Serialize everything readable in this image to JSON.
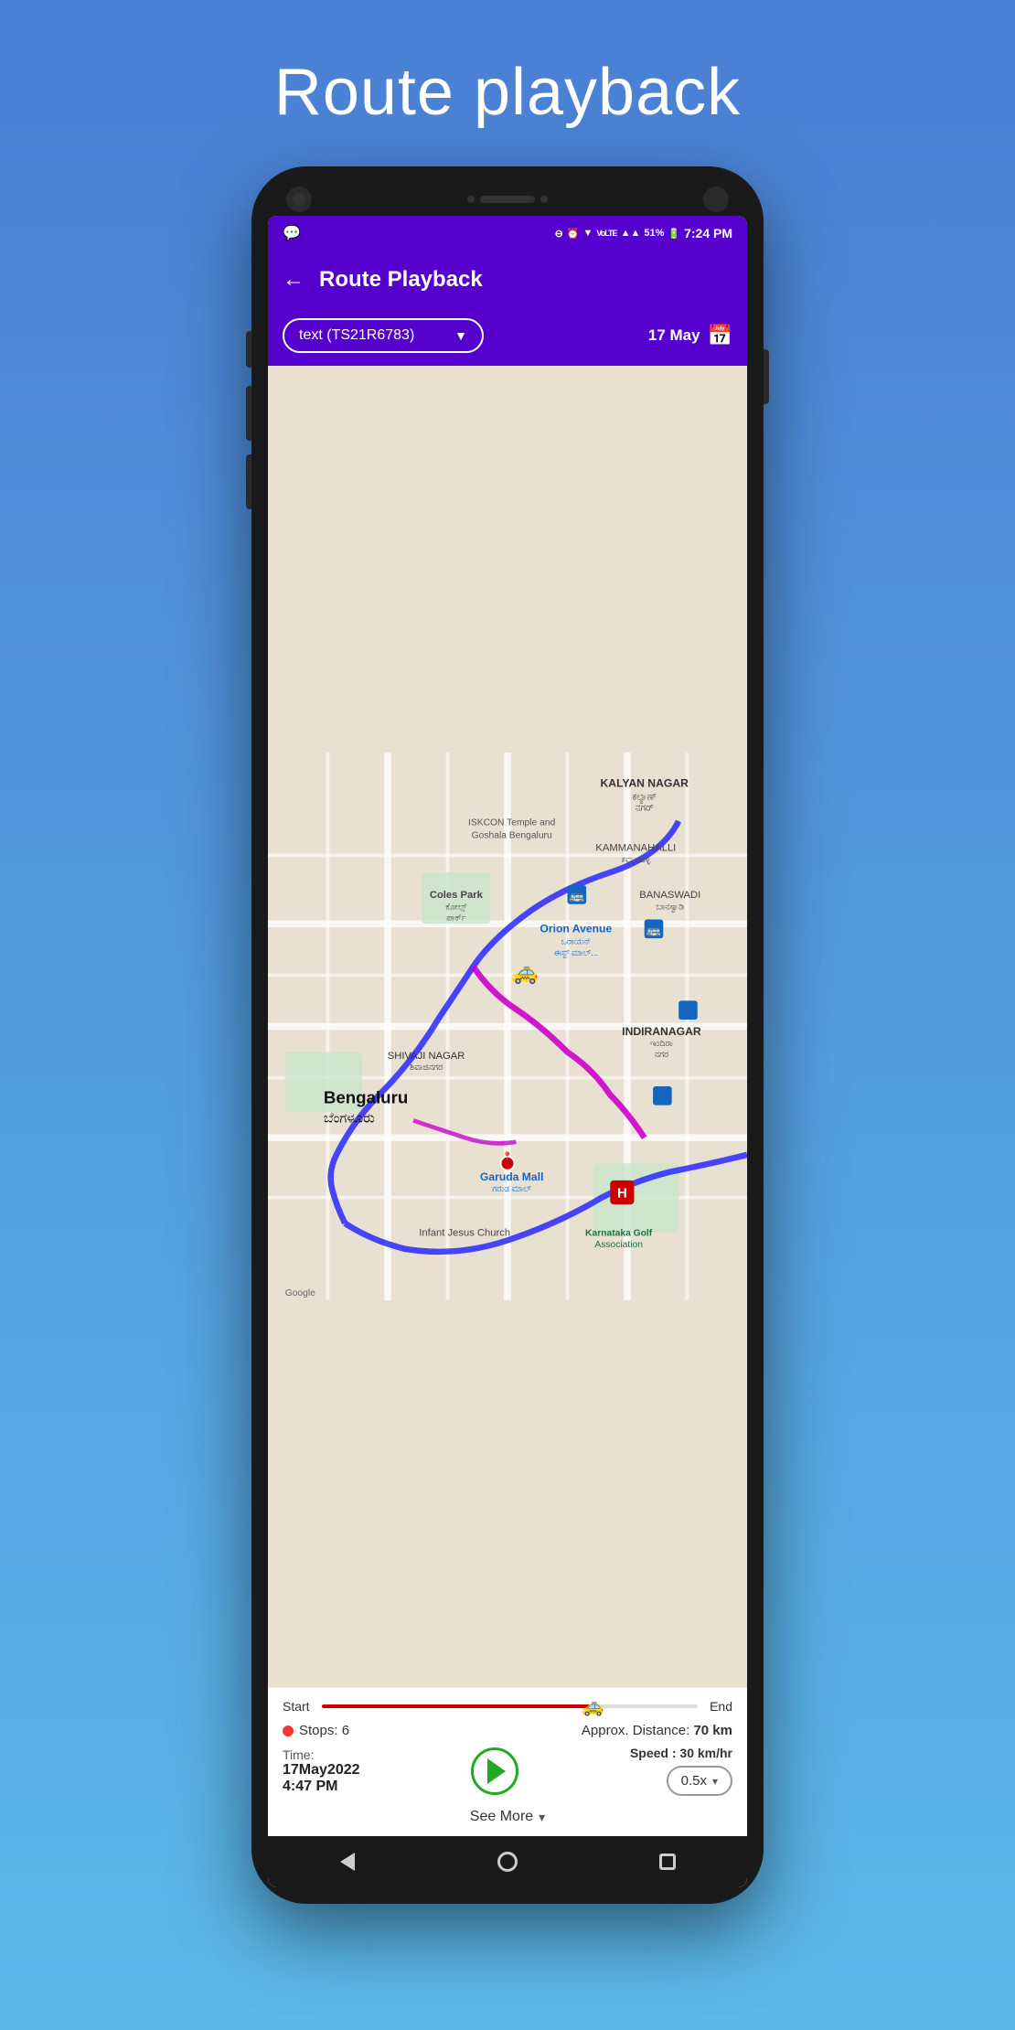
{
  "page": {
    "background_gradient_start": "#4a7fd4",
    "background_gradient_end": "#5bb8e8",
    "title": "Route playback"
  },
  "status_bar": {
    "battery": "51%",
    "time": "7:24 PM",
    "icons": [
      "whatsapp",
      "minus",
      "alarm",
      "wifi",
      "volte1",
      "volte2",
      "signal1",
      "signal2"
    ]
  },
  "app_bar": {
    "back_label": "←",
    "title": "Route Playback"
  },
  "toolbar": {
    "vehicle_label": "text (TS21R6783)",
    "dropdown_arrow": "▼",
    "date_label": "17 May",
    "calendar_icon": "📅"
  },
  "map": {
    "areas": [
      "KALYAN NAGAR",
      "KAMMANAHALLI",
      "BANASWADI",
      "INDIRANAGAR",
      "Coles Park",
      "Orion Avenue",
      "SHIVAJI NAGAR",
      "Garuda Mall",
      "Infant Jesus Church",
      "Karnataka Golf Association",
      "Bengaluru",
      "ISKCON Temple and Goshala Bengaluru"
    ]
  },
  "bottom_panel": {
    "slider": {
      "start_label": "Start",
      "end_label": "End",
      "fill_percent": 72
    },
    "stops": {
      "dot_color": "#ff3333",
      "label": "Stops: 6"
    },
    "distance": {
      "label": "Approx. Distance:",
      "value": "70 km"
    },
    "time": {
      "label": "Time:",
      "value": "17May2022\n4:47 PM"
    },
    "speed": {
      "label": "Speed : 30 km/hr",
      "dropdown_value": "0.5x",
      "dropdown_arrow": "▾"
    },
    "see_more": {
      "label": "See More",
      "arrow": "▾"
    }
  },
  "nav": {
    "back": "◁",
    "home": "○",
    "recents": "□"
  }
}
